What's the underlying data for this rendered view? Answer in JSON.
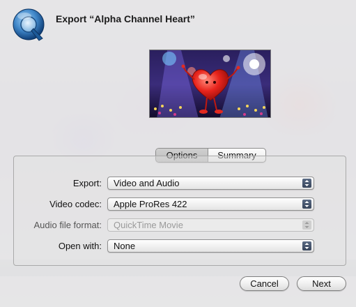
{
  "dialog": {
    "title": "Export “Alpha Channel Heart”",
    "app_icon": "quicktime-icon"
  },
  "preview": {
    "image": "heart-character-concert-preview"
  },
  "tabs": [
    {
      "label": "Options",
      "selected": true
    },
    {
      "label": "Summary",
      "selected": false
    }
  ],
  "fields": [
    {
      "label": "Export:",
      "value": "Video and Audio",
      "enabled": true
    },
    {
      "label": "Video codec:",
      "value": "Apple ProRes 422",
      "enabled": true
    },
    {
      "label": "Audio file format:",
      "value": "QuickTime Movie",
      "enabled": false
    },
    {
      "label": "Open with:",
      "value": "None",
      "enabled": true
    }
  ],
  "buttons": {
    "cancel": "Cancel",
    "next": "Next"
  },
  "colors": {
    "popup_arrow": "#3f4d66",
    "sheet_bg": "#ececec"
  }
}
